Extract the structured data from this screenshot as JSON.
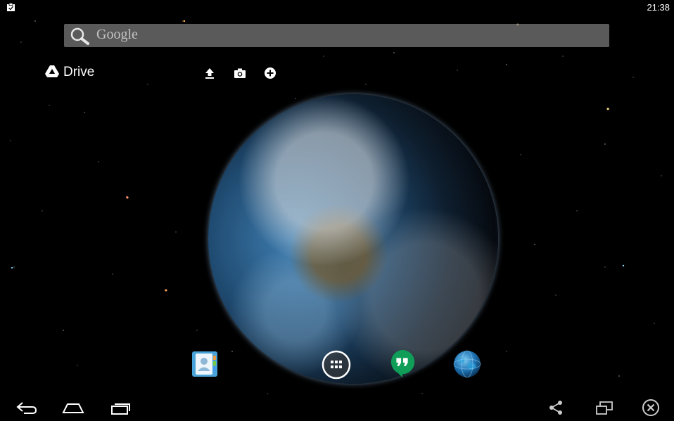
{
  "status_bar": {
    "time": "21:38",
    "notification_icon": "clipboard-notification-icon"
  },
  "search": {
    "label": "Google",
    "icon": "search-icon"
  },
  "drive_widget": {
    "label": "Drive",
    "actions": [
      "upload-icon",
      "camera-icon",
      "add-icon"
    ]
  },
  "dock": {
    "apps": [
      "contacts-icon",
      "all-apps-icon",
      "hangouts-icon",
      "browser-globe-icon"
    ]
  },
  "nav_bar": {
    "buttons": [
      "back-icon",
      "home-icon",
      "recent-apps-icon",
      "share-icon",
      "resize-window-icon",
      "close-icon"
    ]
  },
  "colors": {
    "search_bg": "#7a7a7a",
    "hangouts_green": "#0f9d58",
    "background": "#000000"
  }
}
